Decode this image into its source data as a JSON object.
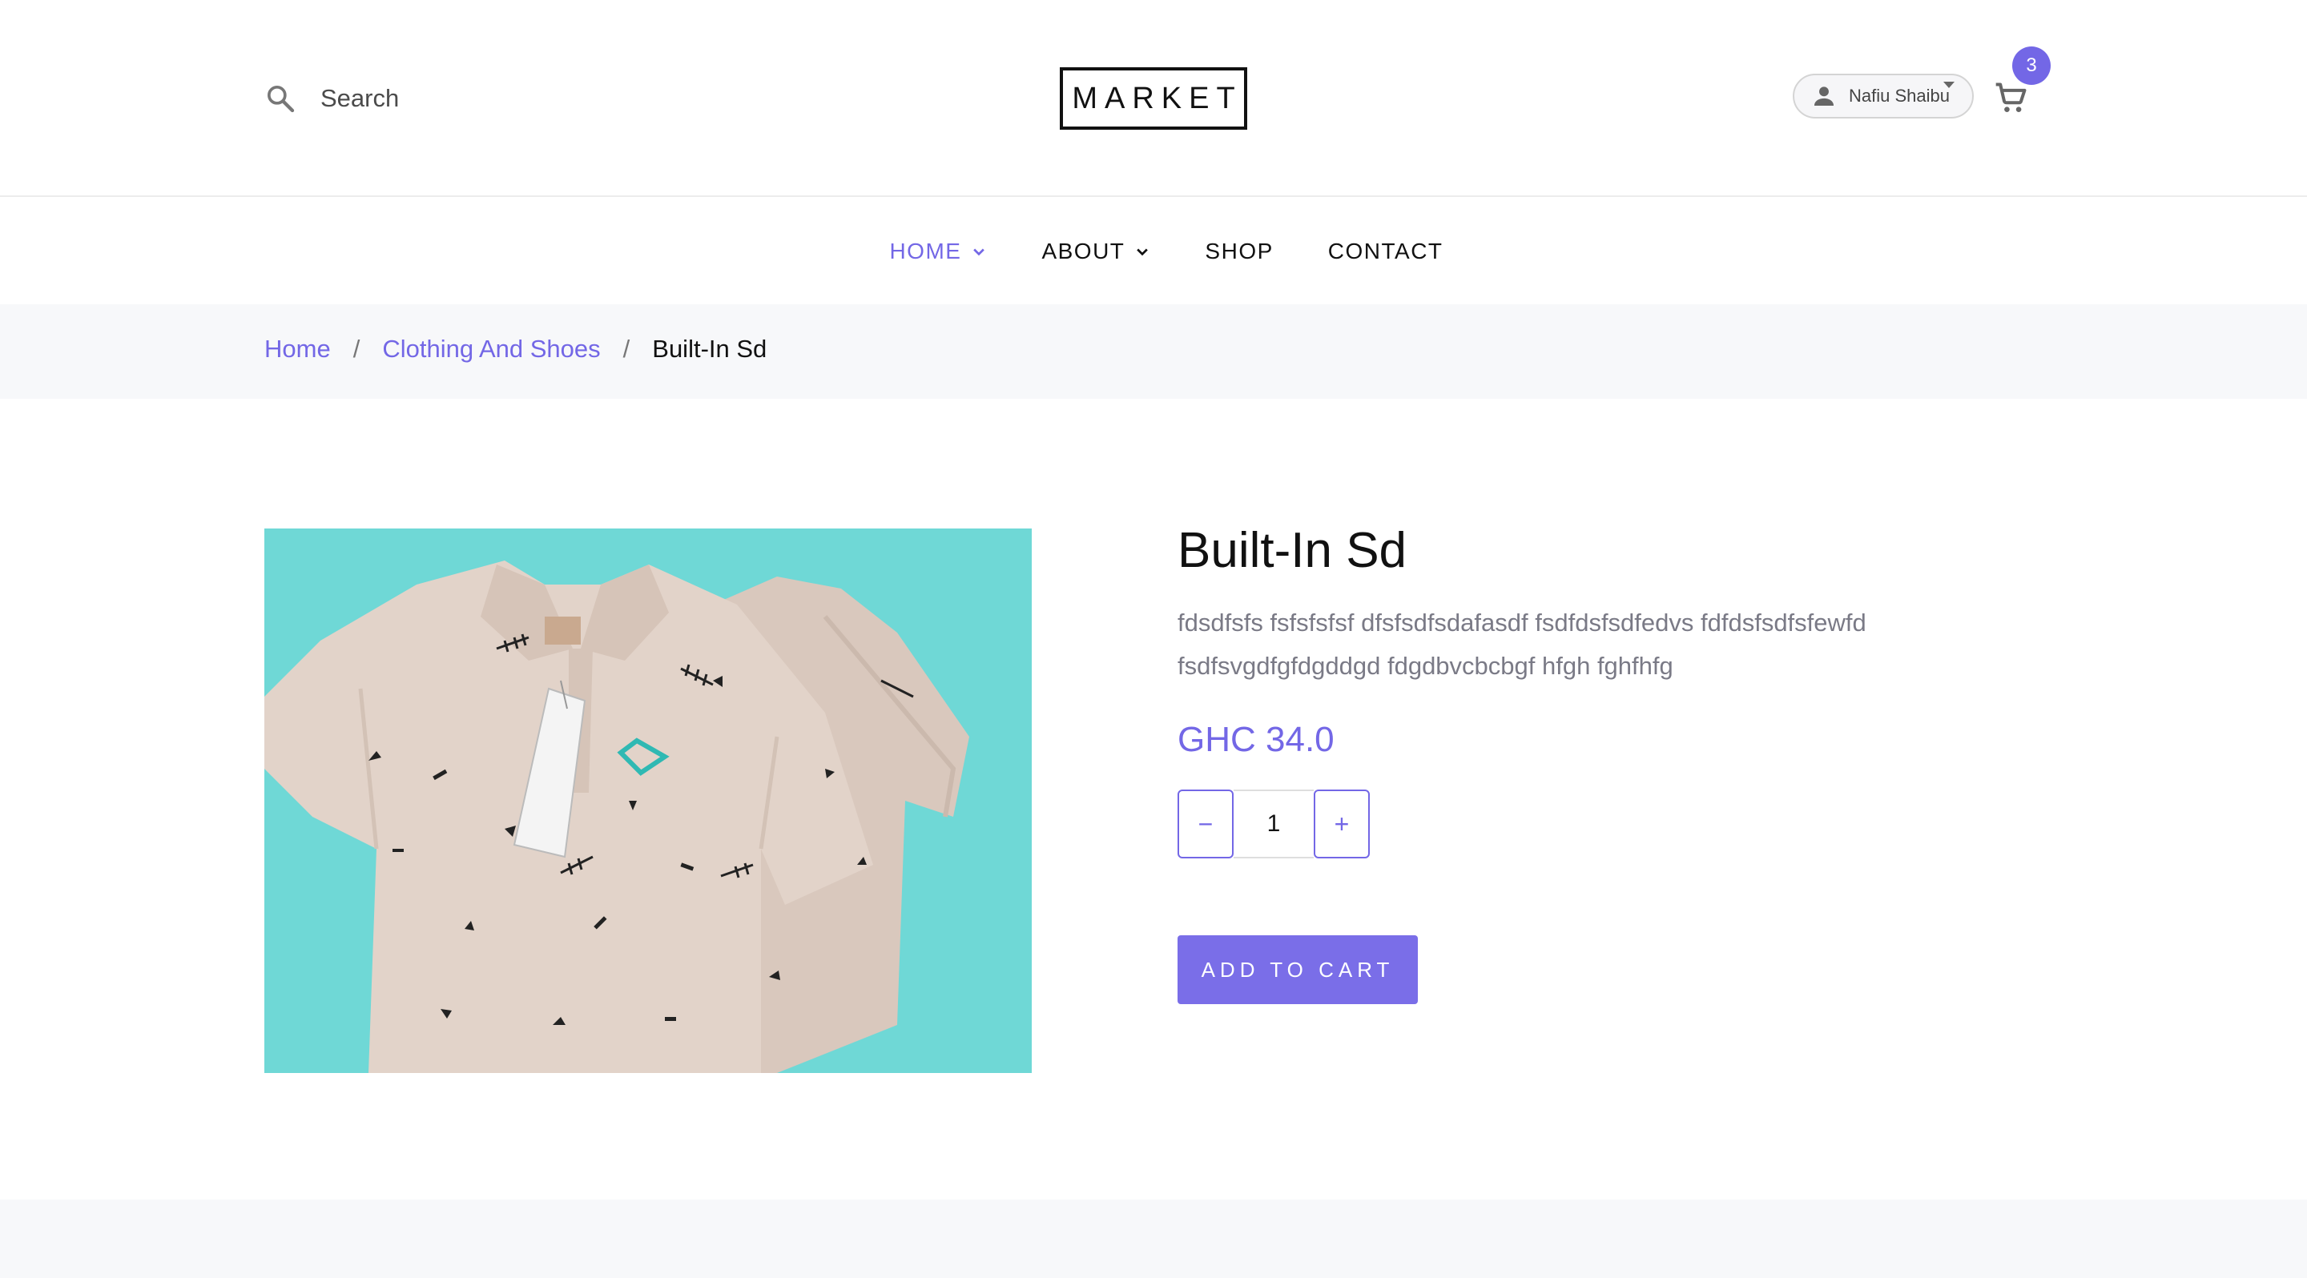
{
  "header": {
    "search_placeholder": "Search",
    "logo_text": "MARKET",
    "user_name": "Nafiu Shaibu",
    "cart_count": "3"
  },
  "nav": {
    "items": [
      {
        "label": "HOME",
        "has_dropdown": true,
        "active": true
      },
      {
        "label": "ABOUT",
        "has_dropdown": true,
        "active": false
      },
      {
        "label": "SHOP",
        "has_dropdown": false,
        "active": false
      },
      {
        "label": "CONTACT",
        "has_dropdown": false,
        "active": false
      }
    ]
  },
  "breadcrumb": {
    "items": [
      {
        "label": "Home",
        "link": true
      },
      {
        "label": "Clothing And Shoes",
        "link": true
      },
      {
        "label": "Built-In Sd",
        "link": false
      }
    ],
    "separator": "/"
  },
  "product": {
    "title": "Built-In Sd",
    "description": "fdsdfsfs fsfsfsfsf dfsfsdfsdafasdf fsdfdsfsdfedvs fdfdsfsdfsfewfd fsdfsvgdfgfdgddgd fdgdbvcbcbgf hfgh fghfhfg",
    "price": "GHC 34.0",
    "quantity": "1",
    "decrement_label": "−",
    "increment_label": "+",
    "add_to_cart_label": "ADD TO CART",
    "image_alt": "polo shirts product image"
  },
  "colors": {
    "accent": "#7367e6",
    "image_background": "#6fd8d6",
    "shirt": "#e2d3c9",
    "subtle_band": "#f7f8fa"
  },
  "icons": {
    "search": "search-icon",
    "user": "user-icon",
    "cart": "cart-icon",
    "dropdown": "chevron-down-icon"
  }
}
